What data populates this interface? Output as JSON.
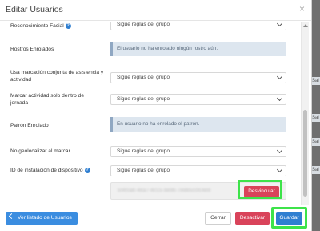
{
  "modal": {
    "title": "Editar Usuarios",
    "close_glyph": "×"
  },
  "rows": {
    "facial": {
      "label": "Reconocimiento Facial",
      "value": "Sigue reglas del grupo"
    },
    "faces_enrolled": {
      "label": "Rostros Enrolados",
      "info": "El usuario no ha enrolado ningún rostro aún."
    },
    "joint_mark": {
      "label_line1": "Usa marcación conjunta de asistencia y",
      "label_line2": "actividad",
      "value": "Sigue reglas del grupo"
    },
    "activity_in_shift": {
      "label_line1": "Marcar actividad solo dentro de",
      "label_line2": "jornada",
      "value": "Sigue reglas del grupo"
    },
    "pattern_enrolled": {
      "label": "Patrón Enrolado",
      "info": "En usuario no ha enrolado el patrón."
    },
    "no_geo": {
      "label": "No geolocalizar al marcar",
      "value": "Sigue reglas del grupo"
    },
    "device_id": {
      "label": "ID de instalación de dispositivo",
      "value": "Sigue reglas del grupo",
      "installation_id": "5f4f0a6-46a7-4015-8e96-7e8b5c0fc4e9",
      "unlink_label": "Desvincular"
    }
  },
  "footer": {
    "back_label": "Ver listado de Usuarios",
    "close_label": "Cerrar",
    "deactivate_label": "Desactivar",
    "save_label": "Guardar"
  },
  "backdrop": {
    "cell_text": "Sal"
  },
  "colors": {
    "primary": "#2f7fd1",
    "danger": "#d9435a",
    "highlight": "#3de34a",
    "info_bg": "#dde6ef"
  }
}
